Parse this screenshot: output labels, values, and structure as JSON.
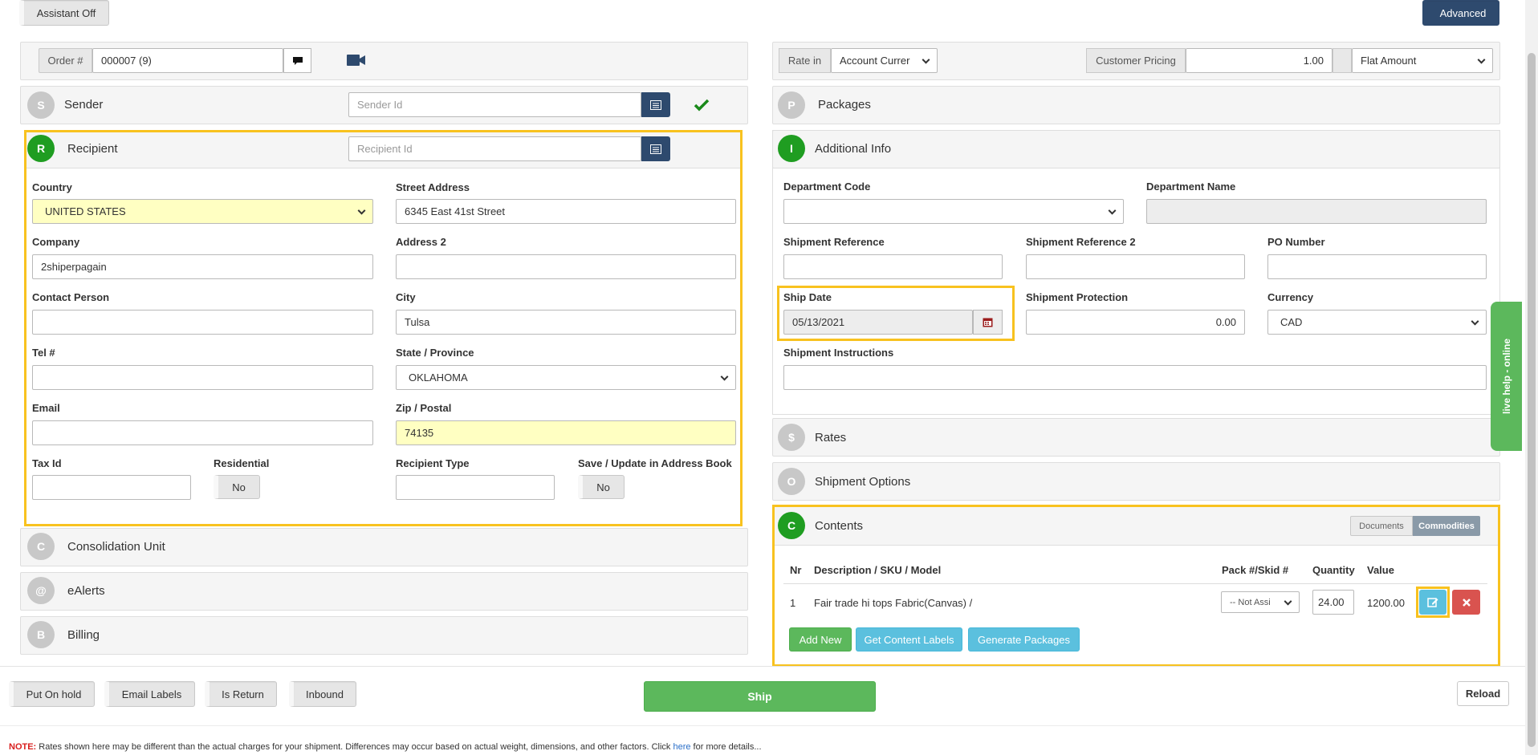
{
  "top": {
    "assistant_label": "Assistant Off",
    "advanced_label": "Advanced"
  },
  "order": {
    "label": "Order #",
    "value": "000007 (9)"
  },
  "sender": {
    "letter": "S",
    "title": "Sender",
    "placeholder": "Sender Id"
  },
  "recipient": {
    "letter": "R",
    "title": "Recipient",
    "placeholder": "Recipient Id",
    "country_label": "Country",
    "country_value": "UNITED STATES",
    "street_label": "Street Address",
    "street_value": "6345 East 41st Street",
    "company_label": "Company",
    "company_value": "2shiperpagain",
    "address2_label": "Address 2",
    "contact_label": "Contact Person",
    "city_label": "City",
    "city_value": "Tulsa",
    "tel_label": "Tel #",
    "state_label": "State / Province",
    "state_value": "OKLAHOMA",
    "email_label": "Email",
    "zip_label": "Zip / Postal",
    "zip_value": "74135",
    "taxid_label": "Tax Id",
    "residential_label": "Residential",
    "residential_value": "No",
    "rtype_label": "Recipient Type",
    "save_label": "Save / Update in Address Book",
    "save_value": "No"
  },
  "consolidation": {
    "letter": "C",
    "title": "Consolidation Unit"
  },
  "ealerts": {
    "letter": "@",
    "title": "eAlerts"
  },
  "billing": {
    "letter": "B",
    "title": "Billing"
  },
  "rate": {
    "label": "Rate in",
    "value": "Account Currer",
    "customer_pricing_label": "Customer Pricing",
    "customer_pricing_value": "1.00",
    "flat_value": "Flat Amount"
  },
  "packages": {
    "letter": "P",
    "title": "Packages"
  },
  "additional": {
    "letter": "I",
    "title": "Additional Info",
    "dept_code_label": "Department Code",
    "dept_name_label": "Department Name",
    "ref_label": "Shipment Reference",
    "ref2_label": "Shipment Reference 2",
    "po_label": "PO Number",
    "ship_date_label": "Ship Date",
    "ship_date_value": "05/13/2021",
    "protection_label": "Shipment Protection",
    "protection_value": "0.00",
    "currency_label": "Currency",
    "currency_value": "CAD",
    "instructions_label": "Shipment Instructions"
  },
  "rates": {
    "letter": "$",
    "title": "Rates"
  },
  "shipment_options": {
    "letter": "O",
    "title": "Shipment Options"
  },
  "contents": {
    "letter": "C",
    "title": "Contents",
    "documents_tab": "Documents",
    "commodities_tab": "Commodities",
    "headers": {
      "nr": "Nr",
      "desc": "Description / SKU / Model",
      "pack": "Pack #/Skid #",
      "qty": "Quantity",
      "value": "Value"
    },
    "row": {
      "nr": "1",
      "desc": "Fair trade hi tops Fabric(Canvas) /",
      "pack": "-- Not Assi",
      "qty": "24.00",
      "value": "1200.00"
    },
    "add_new": "Add New",
    "get_labels": "Get Content Labels",
    "generate": "Generate Packages"
  },
  "bottom": {
    "on_hold": "Put On hold",
    "email_labels": "Email Labels",
    "is_return": "Is Return",
    "inbound": "Inbound",
    "ship": "Ship",
    "reload": "Reload"
  },
  "note": {
    "prefix": "NOTE:",
    "text": " Rates shown here may be different than the actual charges for your shipment. Differences may occur based on actual weight, dimensions, and other factors. Click ",
    "link": "here",
    "suffix": " for more details..."
  },
  "live_help": "live help - online",
  "colors": {
    "accent_green": "#1f9d21",
    "navy": "#2e4a6e",
    "highlight": "#f8c21f",
    "ship_green": "#5cb85c",
    "info": "#5bc0de",
    "danger": "#d9534f"
  }
}
